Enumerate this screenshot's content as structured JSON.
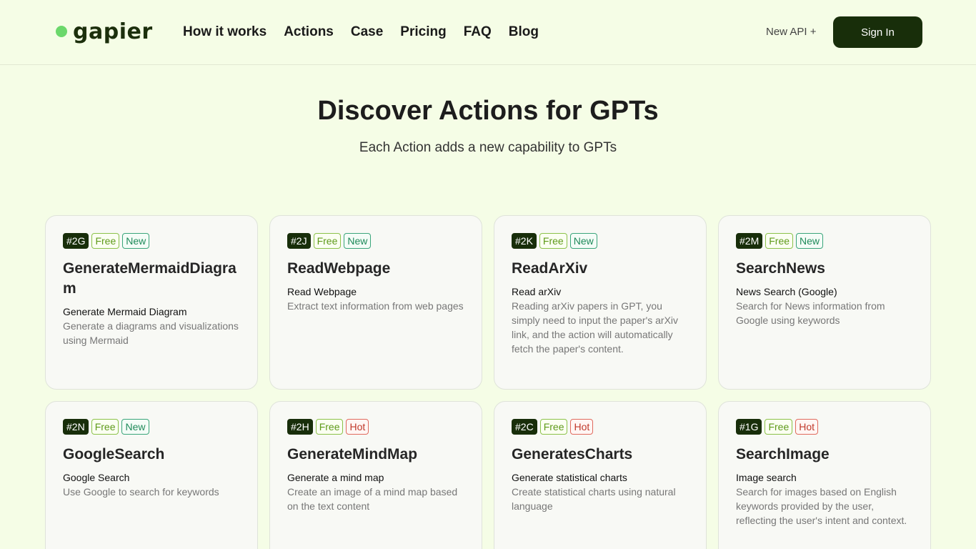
{
  "brand": {
    "name": "gapier",
    "dot_color": "#6bd86b"
  },
  "nav": [
    {
      "label": "How it works"
    },
    {
      "label": "Actions"
    },
    {
      "label": "Case"
    },
    {
      "label": "Pricing"
    },
    {
      "label": "FAQ"
    },
    {
      "label": "Blog"
    }
  ],
  "header": {
    "new_api_label": "New API +",
    "sign_in_label": "Sign In"
  },
  "hero": {
    "title": "Discover Actions for GPTs",
    "subtitle": "Each Action adds a new capability to GPTs"
  },
  "cards": [
    {
      "id": "#2G",
      "price": "Free",
      "badge": "New",
      "badge_type": "new",
      "title": "GenerateMermaidDiagram",
      "subtitle": "Generate Mermaid Diagram",
      "description": "Generate a diagrams and visualizations using Mermaid"
    },
    {
      "id": "#2J",
      "price": "Free",
      "badge": "New",
      "badge_type": "new",
      "title": "ReadWebpage",
      "subtitle": "Read Webpage",
      "description": "Extract text information from web pages"
    },
    {
      "id": "#2K",
      "price": "Free",
      "badge": "New",
      "badge_type": "new",
      "title": "ReadArXiv",
      "subtitle": "Read arXiv",
      "description": "Reading arXiv papers in GPT, you simply need to input the paper's arXiv link, and the action will automatically fetch the paper's content."
    },
    {
      "id": "#2M",
      "price": "Free",
      "badge": "New",
      "badge_type": "new",
      "title": "SearchNews",
      "subtitle": "News Search (Google)",
      "description": "Search for News information from Google using keywords"
    },
    {
      "id": "#2N",
      "price": "Free",
      "badge": "New",
      "badge_type": "new",
      "title": "GoogleSearch",
      "subtitle": "Google Search",
      "description": "Use Google to search for keywords"
    },
    {
      "id": "#2H",
      "price": "Free",
      "badge": "Hot",
      "badge_type": "hot",
      "title": "GenerateMindMap",
      "subtitle": "Generate a mind map",
      "description": "Create an image of a mind map based on the text content"
    },
    {
      "id": "#2C",
      "price": "Free",
      "badge": "Hot",
      "badge_type": "hot",
      "title": "GeneratesCharts",
      "subtitle": "Generate statistical charts",
      "description": "Create statistical charts using natural language"
    },
    {
      "id": "#1G",
      "price": "Free",
      "badge": "Hot",
      "badge_type": "hot",
      "title": "SearchImage",
      "subtitle": "Image search",
      "description": "Search for images based on English keywords provided by the user, reflecting the user's intent and context."
    }
  ]
}
